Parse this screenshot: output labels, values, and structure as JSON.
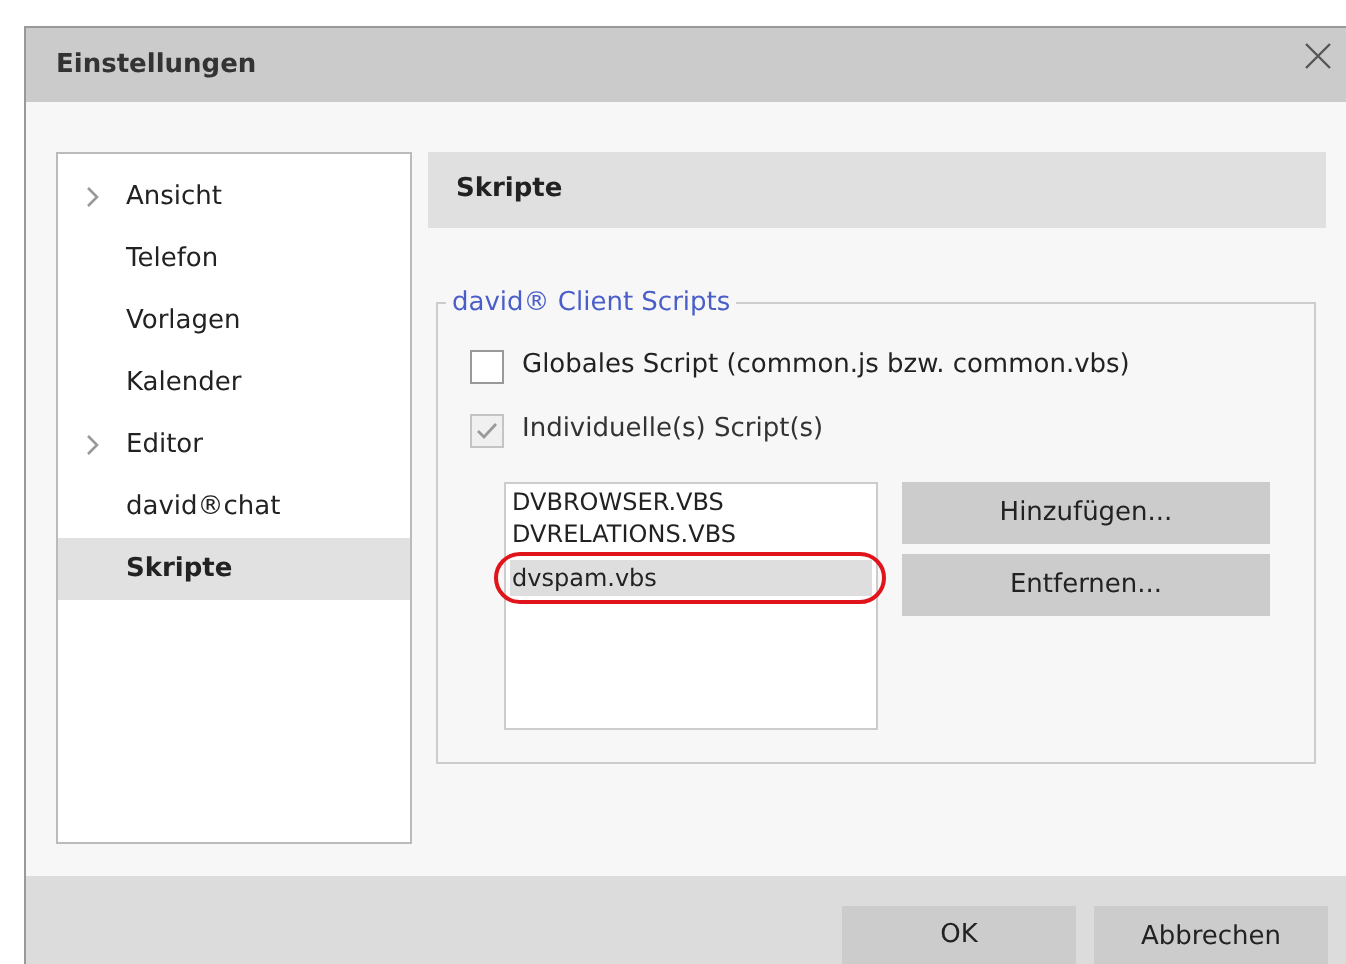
{
  "window": {
    "title": "Einstellungen"
  },
  "sidebar": {
    "items": [
      {
        "label": "Ansicht",
        "expandable": true,
        "selected": false
      },
      {
        "label": "Telefon",
        "expandable": false,
        "selected": false
      },
      {
        "label": "Vorlagen",
        "expandable": false,
        "selected": false
      },
      {
        "label": "Kalender",
        "expandable": false,
        "selected": false
      },
      {
        "label": "Editor",
        "expandable": true,
        "selected": false
      },
      {
        "label": "david®chat",
        "expandable": false,
        "selected": false
      },
      {
        "label": "Skripte",
        "expandable": false,
        "selected": true
      }
    ]
  },
  "page_header": "Skripte",
  "group": {
    "title": "david® Client Scripts",
    "options": [
      {
        "label": "Globales Script (common.js bzw. common.vbs)",
        "checked": false,
        "disabled": false
      },
      {
        "label": "Individuelle(s) Script(s)",
        "checked": true,
        "disabled": true
      }
    ],
    "scripts": [
      {
        "name": "DVBROWSER.VBS",
        "selected": false,
        "highlighted": false
      },
      {
        "name": "DVRELATIONS.VBS",
        "selected": false,
        "highlighted": false
      },
      {
        "name": "dvspam.vbs",
        "selected": true,
        "highlighted": true
      }
    ],
    "buttons": [
      "Hinzufügen...",
      "Entfernen..."
    ]
  },
  "footer": {
    "buttons": [
      {
        "label": "OK",
        "default": true
      },
      {
        "label": "Abbrechen",
        "default": false
      }
    ]
  }
}
